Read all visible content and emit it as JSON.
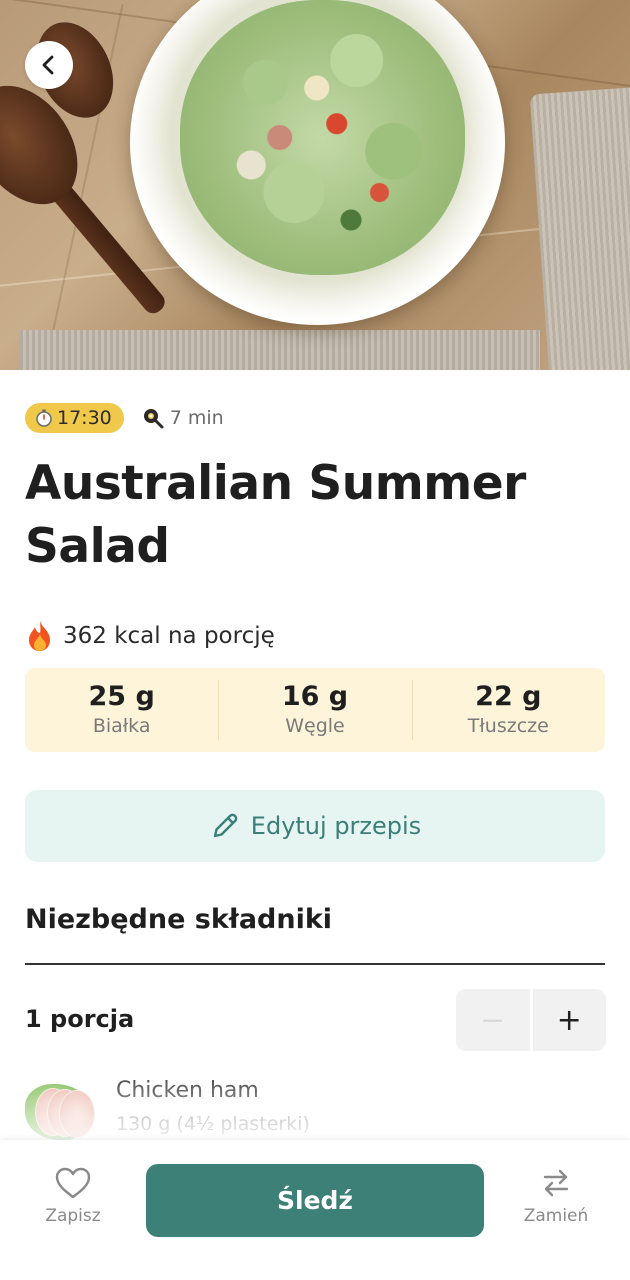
{
  "hero": {
    "image_description_icon": "salad-photo",
    "back_icon": "chevron-left-icon"
  },
  "meta": {
    "time": "17:30",
    "time_icon": "stopwatch-icon",
    "duration": "7 min",
    "duration_icon": "frying-pan-icon",
    "badge_color": "#f1c94a"
  },
  "recipe": {
    "title": "Australian Summer Salad"
  },
  "nutrition": {
    "kcal_text": "362 kcal na porcję",
    "kcal_icon": "fire-icon",
    "macros": [
      {
        "value": "25 g",
        "label": "Białka"
      },
      {
        "value": "16 g",
        "label": "Węgle"
      },
      {
        "value": "22 g",
        "label": "Tłuszcze"
      }
    ]
  },
  "edit": {
    "label": "Edytuj przepis",
    "icon": "pencil-icon"
  },
  "ingredients": {
    "section_title": "Niezbędne składniki",
    "portion_label": "1 porcja",
    "stepper": {
      "minus": "−",
      "plus": "+"
    },
    "items": [
      {
        "name": "Chicken ham",
        "amount": "130 g (4½ plasterki)"
      }
    ]
  },
  "bottom_bar": {
    "save_label": "Zapisz",
    "save_icon": "heart-icon",
    "track_label": "Śledź",
    "swap_label": "Zamień",
    "swap_icon": "swap-arrows-icon",
    "accent": "#3c8077"
  }
}
